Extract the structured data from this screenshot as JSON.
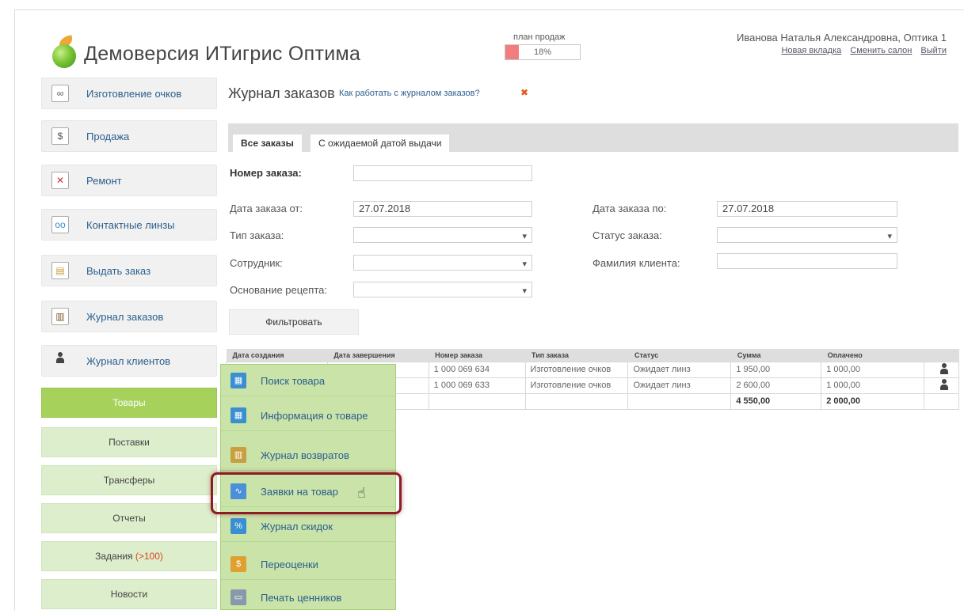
{
  "header": {
    "app_title": "Демоверсия ИТигрис Оптима",
    "plan_label": "план продаж",
    "plan_percent": "18%",
    "plan_fraction": 0.18,
    "user_name": "Иванова Наталья Александровна, Оптика 1",
    "links": {
      "new_tab": "Новая вкладка",
      "change_salon": "Сменить салон",
      "logout": "Выйти"
    }
  },
  "sidebar": {
    "items": [
      {
        "label": "Изготовление очков",
        "icon": "glasses-icon"
      },
      {
        "label": "Продажа",
        "icon": "money-icon"
      },
      {
        "label": "Ремонт",
        "icon": "tools-icon"
      },
      {
        "label": "Контактные линзы",
        "icon": "lens-icon"
      },
      {
        "label": "Выдать заказ",
        "icon": "hand-over-icon"
      },
      {
        "label": "Журнал заказов",
        "icon": "journal-icon"
      },
      {
        "label": "Журнал клиентов",
        "icon": "clients-icon"
      }
    ],
    "subitems": [
      "Товары",
      "Поставки",
      "Трансферы",
      "Отчеты",
      "Задания",
      "Новости"
    ],
    "tasks_count": "(>100)"
  },
  "main": {
    "title": "Журнал заказов",
    "help_link": "Как работать с журналом заказов?",
    "tabs": [
      "Все заказы",
      "С ожидаемой датой выдачи"
    ],
    "filters": {
      "order_number_label": "Номер заказа:",
      "order_number_value": "",
      "date_from_label": "Дата заказа от:",
      "date_from_value": "27.07.2018",
      "date_to_label": "Дата заказа по:",
      "date_to_value": "27.07.2018",
      "order_type_label": "Тип заказа:",
      "order_status_label": "Статус заказа:",
      "employee_label": "Сотрудник:",
      "client_surname_label": "Фамилия клиента:",
      "recipe_basis_label": "Основание рецепта:"
    },
    "filter_button": "Фильтровать",
    "table": {
      "headers": [
        "Дата создания",
        "Дата завершения",
        "Номер заказа",
        "Тип заказа",
        "Статус",
        "Сумма",
        "Оплачено"
      ],
      "rows": [
        {
          "number": "1 000 069 634",
          "type": "Изготовление очков",
          "status": "Ожидает линз",
          "sum": "1 950,00",
          "paid": "1 000,00"
        },
        {
          "number": "1 000 069 633",
          "type": "Изготовление очков",
          "status": "Ожидает линз",
          "sum": "2 600,00",
          "paid": "1 000,00"
        }
      ],
      "total": {
        "sum": "4 550,00",
        "paid": "2 000,00"
      }
    }
  },
  "popup_menu": {
    "items": [
      {
        "label": "Поиск товара",
        "icon": "product-search-icon",
        "color": "#3a8fd0"
      },
      {
        "label": "Информация о товаре",
        "icon": "product-info-icon",
        "color": "#3a8fd0"
      },
      {
        "label": "Журнал возвратов",
        "icon": "returns-journal-icon",
        "color": "#c9a040"
      },
      {
        "label": "Заявки на товар",
        "icon": "product-request-icon",
        "color": "#4a8fd8"
      },
      {
        "label": "Журнал скидок",
        "icon": "discount-icon",
        "color": "#3a8fd0"
      },
      {
        "label": "Переоценки",
        "icon": "revaluation-icon",
        "color": "#e0a030"
      },
      {
        "label": "Печать ценников",
        "icon": "price-tag-print-icon",
        "color": "#8899aa"
      }
    ],
    "highlighted_index": 3
  }
}
